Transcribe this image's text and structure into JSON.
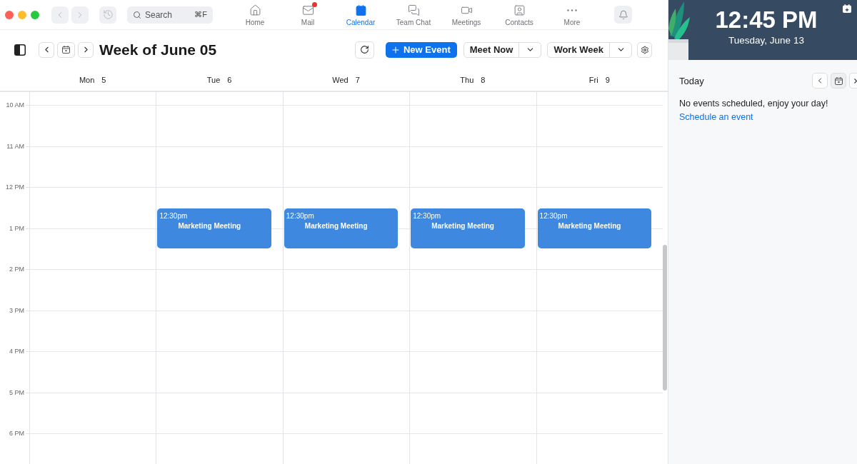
{
  "top_bar": {
    "search": {
      "placeholder": "Search",
      "shortcut": "⌘F"
    },
    "nav": [
      {
        "kind": "home",
        "label": "Home",
        "selected": false,
        "notification": false
      },
      {
        "kind": "mail",
        "label": "Mail",
        "selected": false,
        "notification": true
      },
      {
        "kind": "calendar",
        "label": "Calendar",
        "selected": true,
        "notification": false
      },
      {
        "kind": "chat",
        "label": "Team Chat",
        "selected": false,
        "notification": false
      },
      {
        "kind": "meetings",
        "label": "Meetings",
        "selected": false,
        "notification": false
      },
      {
        "kind": "contacts",
        "label": "Contacts",
        "selected": false,
        "notification": false
      },
      {
        "kind": "more",
        "label": "More",
        "selected": false,
        "notification": false
      }
    ]
  },
  "toolbar": {
    "title": "Week of June 05",
    "new_event": "New Event",
    "meet_now": "Meet Now",
    "view": "Work Week"
  },
  "calendar": {
    "days": [
      {
        "name": "Mon",
        "date": "5"
      },
      {
        "name": "Tue",
        "date": "6",
        "events": [
          {
            "time": "12:30pm",
            "title": "Marketing Meeting"
          }
        ]
      },
      {
        "name": "Wed",
        "date": "7",
        "events": [
          {
            "time": "12:30pm",
            "title": "Marketing Meeting"
          }
        ]
      },
      {
        "name": "Thu",
        "date": "8",
        "events": [
          {
            "time": "12:30pm",
            "title": "Marketing Meeting"
          }
        ]
      },
      {
        "name": "Fri",
        "date": "9",
        "events": [
          {
            "time": "12:30pm",
            "title": "Marketing Meeting"
          }
        ]
      }
    ],
    "hours": [
      "10 AM",
      "11 AM",
      "12 PM",
      "1 PM",
      "2 PM",
      "3 PM",
      "4 PM",
      "5 PM",
      "6 PM"
    ]
  },
  "today_panel": {
    "time": "12:45 PM",
    "date": "Tuesday, June 13",
    "heading": "Today",
    "message": "No events scheduled, enjoy your day!",
    "link": "Schedule an event"
  }
}
